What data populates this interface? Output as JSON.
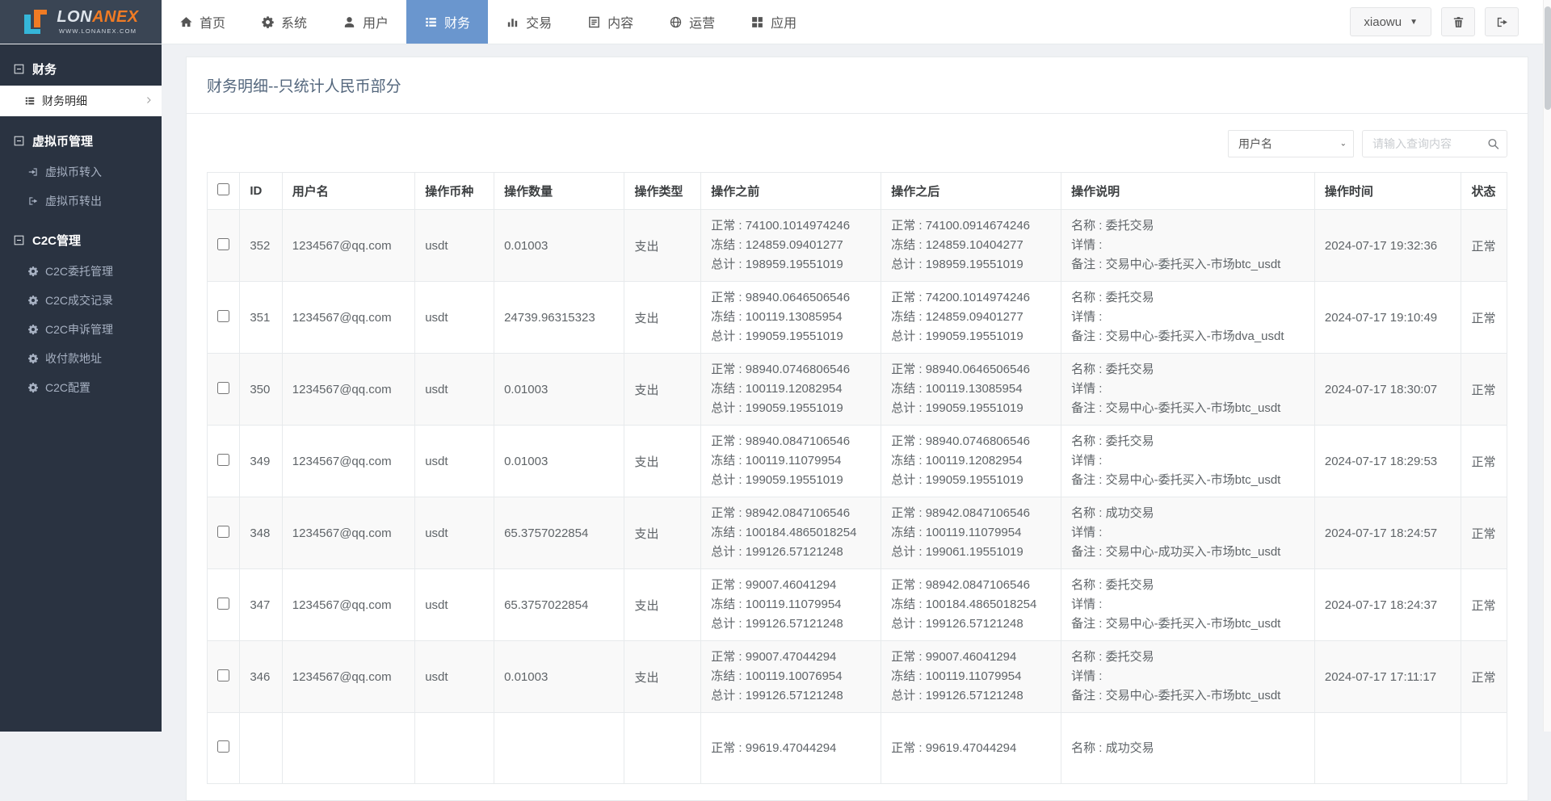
{
  "colors": {
    "accent_blue": "#6a96ce",
    "logo_bg": "#3a4554",
    "sidebar_bg": "#2a3341",
    "logo_orange": "#f07b24",
    "logo_cyan": "#35b6d9",
    "border": "#e7eaec",
    "stripe": "#f9f9f9"
  },
  "logo": {
    "name_a": "LON",
    "name_b": "ANEX",
    "subtitle": "WWW.LONANEX.COM"
  },
  "topnav": {
    "items": [
      {
        "label": "首页",
        "icon": "home-icon",
        "active": false
      },
      {
        "label": "系统",
        "icon": "gear-icon",
        "active": false
      },
      {
        "label": "用户",
        "icon": "user-icon",
        "active": false
      },
      {
        "label": "财务",
        "icon": "list-icon",
        "active": true
      },
      {
        "label": "交易",
        "icon": "bar-chart-icon",
        "active": false
      },
      {
        "label": "内容",
        "icon": "document-icon",
        "active": false
      },
      {
        "label": "运营",
        "icon": "globe-icon",
        "active": false
      },
      {
        "label": "应用",
        "icon": "grid-icon",
        "active": false
      }
    ],
    "user_menu": {
      "label": "xiaowu",
      "caret": "▼"
    },
    "buttons": [
      {
        "icon": "trash-icon"
      },
      {
        "icon": "sign-out-icon"
      }
    ]
  },
  "sidebar": {
    "sections": [
      {
        "header": "财务",
        "items": [
          {
            "label": "财务明细",
            "icon": "list-icon",
            "active": true
          }
        ]
      },
      {
        "header": "虚拟币管理",
        "items": [
          {
            "label": "虚拟币转入",
            "icon": "sign-in-icon",
            "active": false
          },
          {
            "label": "虚拟币转出",
            "icon": "sign-out-icon",
            "active": false
          }
        ]
      },
      {
        "header": "C2C管理",
        "items": [
          {
            "label": "C2C委托管理",
            "icon": "gear-icon",
            "active": false
          },
          {
            "label": "C2C成交记录",
            "icon": "gear-icon",
            "active": false
          },
          {
            "label": "C2C申诉管理",
            "icon": "gear-icon",
            "active": false
          },
          {
            "label": "收付款地址",
            "icon": "gear-icon",
            "active": false
          },
          {
            "label": "C2C配置",
            "icon": "gear-icon",
            "active": false
          }
        ]
      }
    ]
  },
  "page": {
    "title": "财务明细--只统计人民币部分"
  },
  "search": {
    "field": "用户名",
    "placeholder": "请输入查询内容",
    "icon": "search-icon"
  },
  "table": {
    "headers": [
      "ID",
      "用户名",
      "操作币种",
      "操作数量",
      "操作类型",
      "操作之前",
      "操作之后",
      "操作说明",
      "操作时间",
      "状态"
    ],
    "rows": [
      {
        "id": "352",
        "user": "1234567@qq.com",
        "coin": "usdt",
        "amount": "0.01003",
        "type": "支出",
        "before": [
          "正常 : 74100.1014974246",
          "冻结 : 124859.09401277",
          "总计 : 198959.19551019"
        ],
        "after": [
          "正常 : 74100.0914674246",
          "冻结 : 124859.10404277",
          "总计 : 198959.19551019"
        ],
        "desc": [
          "名称 : 委托交易",
          "详情 :",
          "备注 : 交易中心-委托买入-市场btc_usdt"
        ],
        "time": "2024-07-17 19:32:36",
        "status": "正常"
      },
      {
        "id": "351",
        "user": "1234567@qq.com",
        "coin": "usdt",
        "amount": "24739.96315323",
        "type": "支出",
        "before": [
          "正常 : 98940.0646506546",
          "冻结 : 100119.13085954",
          "总计 : 199059.19551019"
        ],
        "after": [
          "正常 : 74200.1014974246",
          "冻结 : 124859.09401277",
          "总计 : 199059.19551019"
        ],
        "desc": [
          "名称 : 委托交易",
          "详情 :",
          "备注 : 交易中心-委托买入-市场dva_usdt"
        ],
        "time": "2024-07-17 19:10:49",
        "status": "正常"
      },
      {
        "id": "350",
        "user": "1234567@qq.com",
        "coin": "usdt",
        "amount": "0.01003",
        "type": "支出",
        "before": [
          "正常 : 98940.0746806546",
          "冻结 : 100119.12082954",
          "总计 : 199059.19551019"
        ],
        "after": [
          "正常 : 98940.0646506546",
          "冻结 : 100119.13085954",
          "总计 : 199059.19551019"
        ],
        "desc": [
          "名称 : 委托交易",
          "详情 :",
          "备注 : 交易中心-委托买入-市场btc_usdt"
        ],
        "time": "2024-07-17 18:30:07",
        "status": "正常"
      },
      {
        "id": "349",
        "user": "1234567@qq.com",
        "coin": "usdt",
        "amount": "0.01003",
        "type": "支出",
        "before": [
          "正常 : 98940.0847106546",
          "冻结 : 100119.11079954",
          "总计 : 199059.19551019"
        ],
        "after": [
          "正常 : 98940.0746806546",
          "冻结 : 100119.12082954",
          "总计 : 199059.19551019"
        ],
        "desc": [
          "名称 : 委托交易",
          "详情 :",
          "备注 : 交易中心-委托买入-市场btc_usdt"
        ],
        "time": "2024-07-17 18:29:53",
        "status": "正常"
      },
      {
        "id": "348",
        "user": "1234567@qq.com",
        "coin": "usdt",
        "amount": "65.3757022854",
        "type": "支出",
        "before": [
          "正常 : 98942.0847106546",
          "冻结 : 100184.4865018254",
          "总计 : 199126.57121248"
        ],
        "after": [
          "正常 : 98942.0847106546",
          "冻结 : 100119.11079954",
          "总计 : 199061.19551019"
        ],
        "desc": [
          "名称 : 成功交易",
          "详情 :",
          "备注 : 交易中心-成功买入-市场btc_usdt"
        ],
        "time": "2024-07-17 18:24:57",
        "status": "正常"
      },
      {
        "id": "347",
        "user": "1234567@qq.com",
        "coin": "usdt",
        "amount": "65.3757022854",
        "type": "支出",
        "before": [
          "正常 : 99007.46041294",
          "冻结 : 100119.11079954",
          "总计 : 199126.57121248"
        ],
        "after": [
          "正常 : 98942.0847106546",
          "冻结 : 100184.4865018254",
          "总计 : 199126.57121248"
        ],
        "desc": [
          "名称 : 委托交易",
          "详情 :",
          "备注 : 交易中心-委托买入-市场btc_usdt"
        ],
        "time": "2024-07-17 18:24:37",
        "status": "正常"
      },
      {
        "id": "346",
        "user": "1234567@qq.com",
        "coin": "usdt",
        "amount": "0.01003",
        "type": "支出",
        "before": [
          "正常 : 99007.47044294",
          "冻结 : 100119.10076954",
          "总计 : 199126.57121248"
        ],
        "after": [
          "正常 : 99007.46041294",
          "冻结 : 100119.11079954",
          "总计 : 199126.57121248"
        ],
        "desc": [
          "名称 : 委托交易",
          "详情 :",
          "备注 : 交易中心-委托买入-市场btc_usdt"
        ],
        "time": "2024-07-17 17:11:17",
        "status": "正常"
      },
      {
        "id": "",
        "user": "",
        "coin": "",
        "amount": "",
        "type": "",
        "before": [
          "正常 : 99619.47044294",
          "",
          ""
        ],
        "after": [
          "正常 : 99619.47044294",
          "",
          ""
        ],
        "desc": [
          "名称 : 成功交易",
          "",
          ""
        ],
        "time": "",
        "status": ""
      }
    ]
  }
}
